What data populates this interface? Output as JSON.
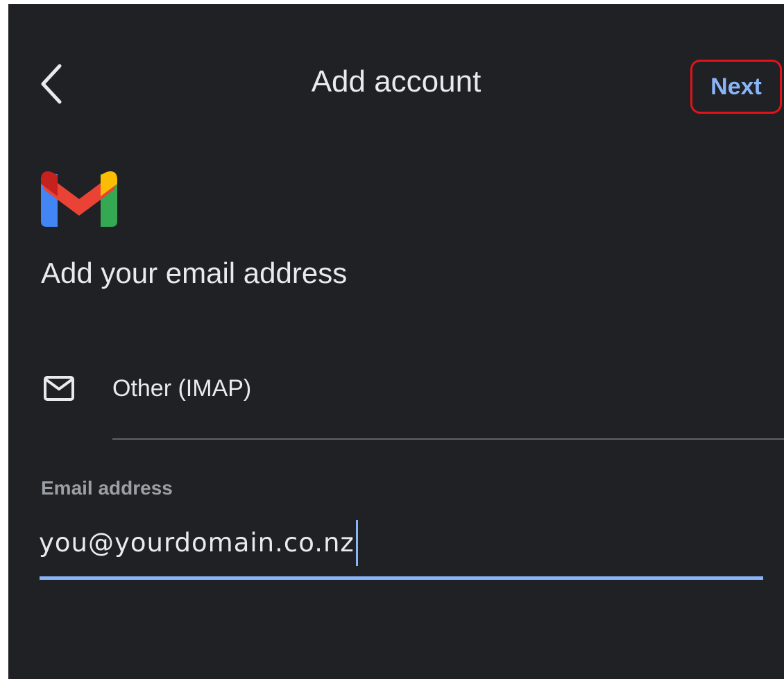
{
  "header": {
    "title": "Add account",
    "next_label": "Next",
    "back_icon": "chevron-left-icon"
  },
  "logo": {
    "name": "gmail-logo-icon",
    "colors": {
      "blue": "#4285f4",
      "red": "#ea4335",
      "dark_red": "#c5221f",
      "yellow": "#fbbc04",
      "green": "#34a853"
    }
  },
  "main": {
    "heading": "Add your email address",
    "provider": {
      "icon": "envelope-icon",
      "label": "Other (IMAP)"
    },
    "email_field": {
      "label": "Email address",
      "value": "you@yourdomain.co.nz"
    }
  },
  "colors": {
    "background": "#202124",
    "text": "#e8eaed",
    "muted_text": "#9aa0a6",
    "accent": "#8ab4f8",
    "highlight_box": "#e0141a",
    "divider": "#5f6368"
  }
}
